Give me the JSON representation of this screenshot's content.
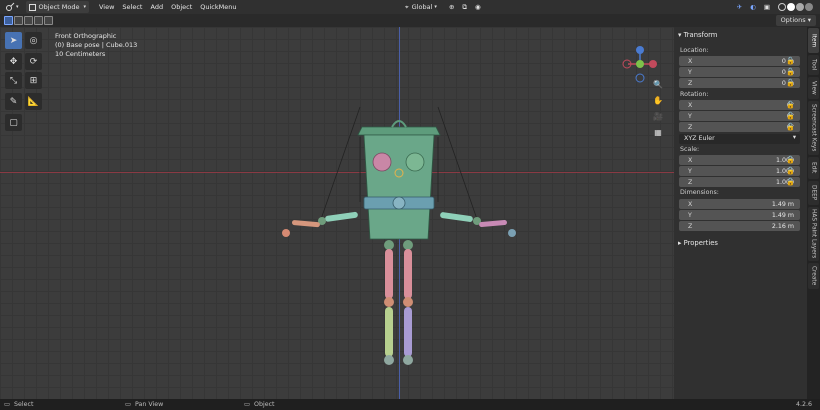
{
  "header": {
    "mode": "Object Mode",
    "menus": [
      "View",
      "Select",
      "Add",
      "Object",
      "QuickMenu"
    ],
    "transform_orientation": "Global",
    "options_label": "Options"
  },
  "viewport": {
    "view_name": "Front Orthographic",
    "collection_info": "(0) Base pose | Cube.013",
    "scale_info": "10 Centimeters"
  },
  "sidebar": {
    "transform_title": "Transform",
    "location": {
      "label": "Location:",
      "x": "0 m",
      "y": "0 m",
      "z": "0 m"
    },
    "rotation": {
      "label": "Rotation:",
      "x": "0°",
      "y": "0°",
      "z": "0°",
      "mode": "XYZ Euler"
    },
    "scale": {
      "label": "Scale:",
      "x": "1.000",
      "y": "1.000",
      "z": "1.000"
    },
    "dimensions": {
      "label": "Dimensions:",
      "x": "1.49 m",
      "y": "1.49 m",
      "z": "2.16 m"
    },
    "properties_title": "Properties",
    "axis_labels": {
      "x": "X",
      "y": "Y",
      "z": "Z"
    }
  },
  "tabs": [
    "Item",
    "Tool",
    "View",
    "Screencast Keys",
    "Edit",
    "DEEP",
    "HAS Paint Layers",
    "Create"
  ],
  "status": {
    "select": "Select",
    "pan": "Pan View",
    "object": "Object",
    "version": "4.2.6"
  },
  "colors": {
    "accent": "#4772b3",
    "viewport_bg": "#3c3c3c",
    "x_axis": "#8a3a44",
    "y_axis": "#4a5fa8"
  }
}
